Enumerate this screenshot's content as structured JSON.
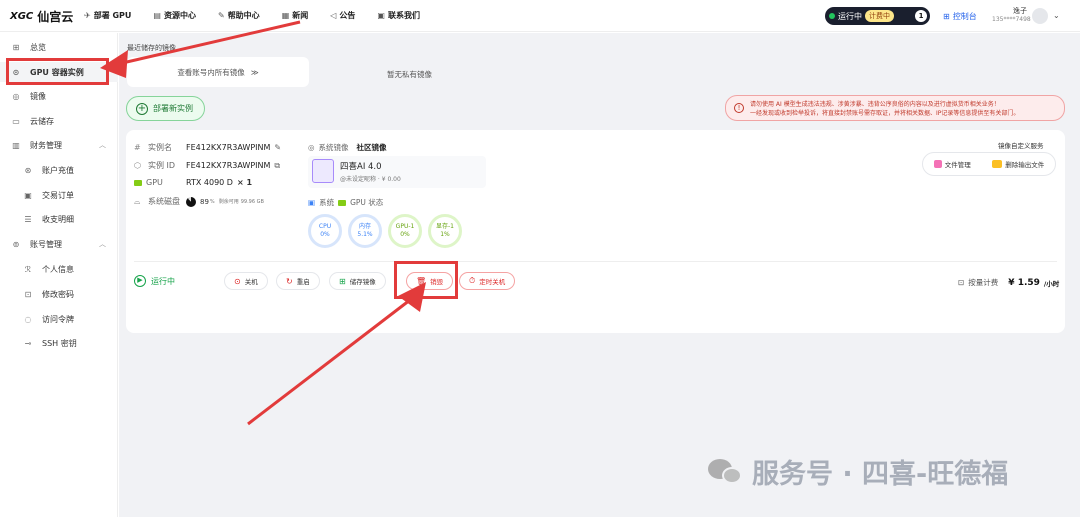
{
  "topbar": {
    "logo_mark": "XGC",
    "logo_text": "仙宫云",
    "nav": [
      {
        "label": "部署 GPU",
        "icon": "rocket-icon",
        "glyph": "✈"
      },
      {
        "label": "资源中心",
        "icon": "book-icon",
        "glyph": "▤"
      },
      {
        "label": "帮助中心",
        "icon": "help-icon",
        "glyph": "✎"
      },
      {
        "label": "新闻",
        "icon": "news-icon",
        "glyph": "▦"
      },
      {
        "label": "公告",
        "icon": "megaphone-icon",
        "glyph": "◁"
      },
      {
        "label": "联系我们",
        "icon": "contact-icon",
        "glyph": "▣"
      }
    ],
    "status_label": "运行中",
    "billing_tag": "计费中",
    "running_count": "1",
    "console_label": "控制台",
    "user_name": "逸子",
    "user_phone": "135****7498"
  },
  "sidebar": {
    "items": [
      {
        "label": "总览",
        "icon": "overview-icon",
        "glyph": "⊞"
      },
      {
        "label": "GPU 容器实例",
        "icon": "gpu-instance-icon",
        "glyph": "⊙"
      },
      {
        "label": "镜像",
        "icon": "image-icon",
        "glyph": "◎"
      },
      {
        "label": "云储存",
        "icon": "cloud-storage-icon",
        "glyph": "▭"
      },
      {
        "label": "财务管理",
        "icon": "finance-icon",
        "glyph": "▥"
      },
      {
        "label": "账户充值",
        "icon": "recharge-icon",
        "glyph": "⊛"
      },
      {
        "label": "交易订单",
        "icon": "order-icon",
        "glyph": "▣"
      },
      {
        "label": "收支明细",
        "icon": "detail-icon",
        "glyph": "☰"
      },
      {
        "label": "账号管理",
        "icon": "account-icon",
        "glyph": "⊚"
      },
      {
        "label": "个人信息",
        "icon": "person-icon",
        "glyph": "ℛ"
      },
      {
        "label": "修改密码",
        "icon": "lock-icon",
        "glyph": "⊡"
      },
      {
        "label": "访问令牌",
        "icon": "token-icon",
        "glyph": "◌"
      },
      {
        "label": "SSH 密钥",
        "icon": "key-icon",
        "glyph": "⊸"
      }
    ]
  },
  "main": {
    "recent_title": "最近储存的镜像",
    "view_all_images": "查看账号内所有镜像",
    "no_private_images": "暂无私有镜像",
    "deploy_label": "部署新实例",
    "warning_line1": "请勿使用 AI 模型生成违法违规、涉黄涉暴、违背公序良俗的内容以及进行虚拟货币相关业务！",
    "warning_line2": "一经发现或收到检举投诉，将直接封禁账号需存取证，并将相关数据、IP记录等信息提供至有关部门。"
  },
  "instance": {
    "name_label": "实例名",
    "name": "FE412KX7R3AWPINM",
    "id_label": "实例 ID",
    "id": "FE412KX7R3AWPINM",
    "gpu_label": "GPU",
    "gpu": "RTX 4090 D",
    "gpu_count": "× 1",
    "disk_label": "系统磁盘",
    "disk_percent": "89",
    "disk_percent_unit": "%",
    "disk_free_label": "剩余可用",
    "disk_free": "99.96 GB",
    "sys_image_label": "系统镜像",
    "sys_image_value": "社区镜像",
    "image_name": "四喜AI 4.0",
    "image_meta": "@未设定昵称 · ¥ 0.00",
    "status_label_system": "系统",
    "status_label_gpu": "GPU 状态",
    "gauges": [
      {
        "label": "CPU",
        "value": "0%",
        "color": "blue"
      },
      {
        "label": "内存",
        "value": "5.1%",
        "color": "blue"
      },
      {
        "label": "GPU-1",
        "value": "0%",
        "color": "green"
      },
      {
        "label": "显存-1",
        "value": "1%",
        "color": "green"
      }
    ],
    "custom_title": "镜像自定义服务",
    "file_manage": "文件管理",
    "delete_output": "删除输出文件",
    "running": "运行中",
    "actions": {
      "shutdown": "关机",
      "restart": "重启",
      "save_image": "储存镜像",
      "destroy": "销毁",
      "timed_shutdown": "定时关机"
    },
    "billing_mode": "按量计费",
    "price": "¥ 1.59",
    "price_unit": "/小时"
  },
  "watermark": {
    "text": "服务号 · 四喜-旺德福"
  },
  "colors": {
    "annotation_red": "#e23b3b",
    "running_green": "#16a34a",
    "console_blue": "#2563eb"
  }
}
